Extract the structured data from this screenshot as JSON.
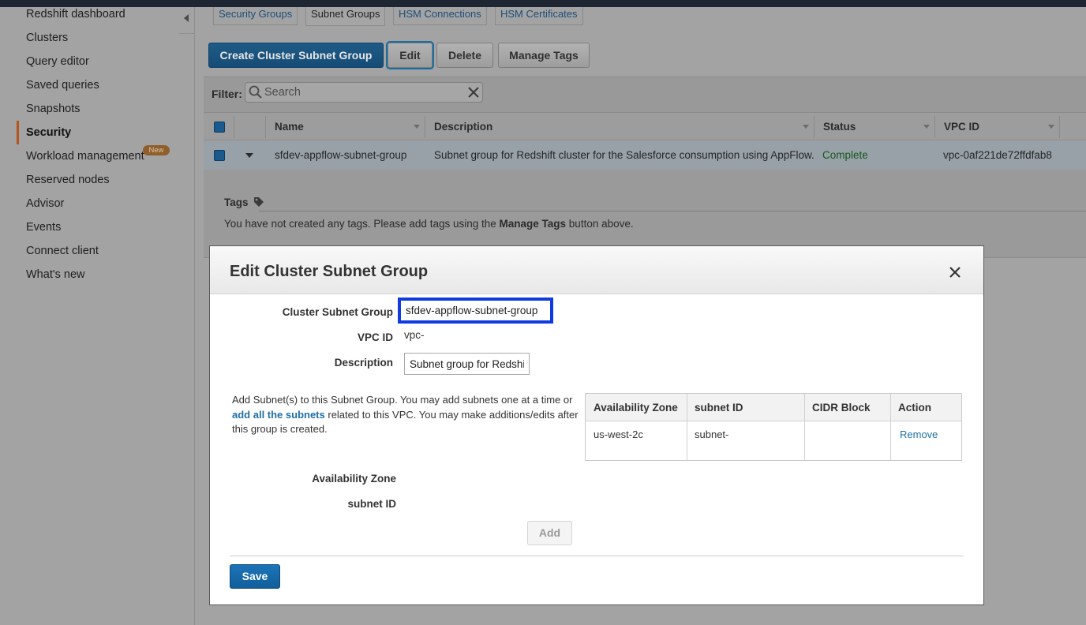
{
  "sidebar": {
    "items": [
      {
        "label": "Redshift dashboard"
      },
      {
        "label": "Clusters"
      },
      {
        "label": "Query editor"
      },
      {
        "label": "Saved queries"
      },
      {
        "label": "Snapshots"
      },
      {
        "label": "Security",
        "active": true
      },
      {
        "label": "Workload management",
        "badge": "New"
      },
      {
        "label": "Reserved nodes"
      },
      {
        "label": "Advisor"
      },
      {
        "label": "Events"
      },
      {
        "label": "Connect client"
      },
      {
        "label": "What's new"
      }
    ]
  },
  "tabs": [
    {
      "label": "Security Groups"
    },
    {
      "label": "Subnet Groups",
      "active": true
    },
    {
      "label": "HSM Connections"
    },
    {
      "label": "HSM Certificates"
    }
  ],
  "toolbar": {
    "create_label": "Create Cluster Subnet Group",
    "edit_label": "Edit",
    "delete_label": "Delete",
    "manage_tags_label": "Manage Tags"
  },
  "filter": {
    "label": "Filter:",
    "placeholder": "Search"
  },
  "table": {
    "columns": [
      "Name",
      "Description",
      "Status",
      "VPC ID"
    ],
    "rows": [
      {
        "name": "sfdev-appflow-subnet-group",
        "description": "Subnet group for Redshift cluster for the Salesforce consumption using AppFlow.",
        "status": "Complete",
        "vpc_id": "vpc-0af221de72ffdfab8"
      }
    ]
  },
  "details": {
    "tags_title": "Tags",
    "tags_text_before": "You have not created any tags. Please add tags using the ",
    "tags_text_bold": "Manage Tags",
    "tags_text_after": " button above."
  },
  "modal": {
    "title": "Edit Cluster Subnet Group",
    "fields": {
      "subnet_group_label": "Cluster Subnet Group",
      "subnet_group_value": "sfdev-appflow-subnet-group",
      "vpc_label": "VPC ID",
      "vpc_value": "vpc-",
      "description_label": "Description",
      "description_value": "Subnet group for Redshift cluster for the Salesforce consumption using AppFlow."
    },
    "help": {
      "before": "Add Subnet(s) to this Subnet Group. You may add subnets one at a time or ",
      "link": "add all the subnets",
      "after": " related to this VPC. You may make additions/edits after this group is created."
    },
    "subnet_table": {
      "columns": [
        "Availability Zone",
        "subnet ID",
        "CIDR Block",
        "Action"
      ],
      "rows": [
        {
          "az": "us-west-2c",
          "subnet_id": "subnet-",
          "cidr": "",
          "action": "Remove"
        }
      ]
    },
    "az_label": "Availability Zone",
    "subnet_id_label": "subnet ID",
    "add_label": "Add",
    "save_label": "Save"
  },
  "colors": {
    "primary_blue": "#1b74b8",
    "status_green": "#15581b",
    "focus_highlight": "#0f3be0",
    "sidebar_accent": "#b4541c"
  }
}
